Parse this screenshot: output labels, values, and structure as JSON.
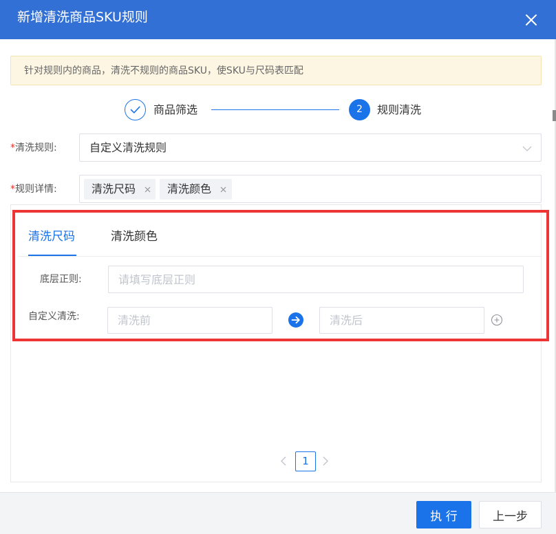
{
  "dialog": {
    "title": "新增清洗商品SKU规则",
    "close_icon": "close-icon"
  },
  "notice": {
    "text": "针对规则内的商品，清洗不规则的商品SKU，使SKU与尺码表匹配"
  },
  "steps": [
    {
      "label": "商品筛选",
      "status": "done",
      "icon": "check-icon"
    },
    {
      "label": "规则清洗",
      "status": "current",
      "number": "2"
    }
  ],
  "form": {
    "required_mark": "*",
    "rule": {
      "label": "清洗规则:",
      "value": "自定义清洗规则"
    },
    "detail": {
      "label": "规则详情:",
      "tags": [
        "清洗尺码",
        "清洗颜色"
      ]
    }
  },
  "rule_tabs": {
    "tabs": [
      "清洗尺码",
      "清洗颜色"
    ],
    "active": 0,
    "base_regex": {
      "label": "底层正则:",
      "placeholder": "请填写底层正则"
    },
    "custom_clean": {
      "label": "自定义清洗:",
      "before_placeholder": "清洗前",
      "after_placeholder": "清洗后"
    }
  },
  "pagination": {
    "current": "1"
  },
  "footer": {
    "execute_label": "执 行",
    "prev_label": "上一步"
  },
  "colors": {
    "header": "#3370d6",
    "primary": "#1a73e8",
    "highlight_border": "#ee3535",
    "notice_bg": "#fdf6e3"
  }
}
